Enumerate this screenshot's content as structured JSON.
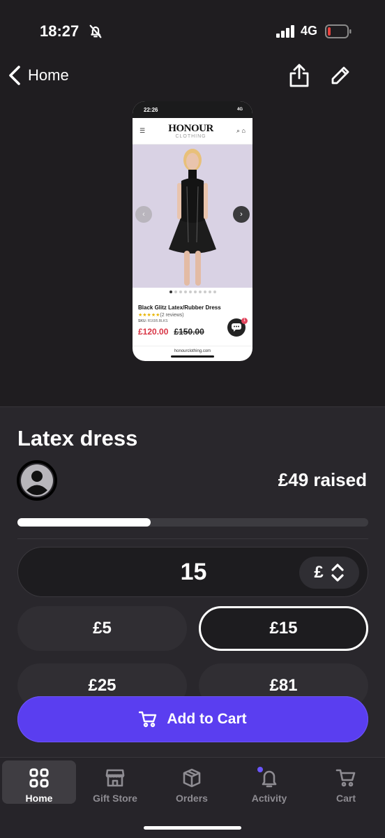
{
  "status_bar": {
    "time": "18:27",
    "network": "4G",
    "icons": [
      "bell-slash-icon",
      "signal-icon",
      "battery-low-icon"
    ]
  },
  "nav": {
    "back_label": "Home",
    "icons": [
      "chevron-left-icon",
      "share-icon",
      "pencil-icon"
    ]
  },
  "preview": {
    "status_time": "22:26",
    "status_network": "4G",
    "brand": "HONOUR",
    "brand_sub": "CLOTHING",
    "product_title": "Black Glitz Latex/Rubber Dress",
    "rating_stars": "★★★★★",
    "reviews": "(2 reviews)",
    "sku_label": "SKU:",
    "sku": "R1695.BLKS",
    "price_now": "£120.00",
    "price_was": "£150.00",
    "chat_badge": "1",
    "url": "honourclothing.com"
  },
  "item": {
    "title": "Latex dress",
    "raised": "£49 raised",
    "progress_fraction": 0.38
  },
  "amount": {
    "value": "15",
    "currency": "£"
  },
  "presets": [
    {
      "label": "£5",
      "selected": false
    },
    {
      "label": "£15",
      "selected": true
    },
    {
      "label": "£25",
      "selected": false
    },
    {
      "label": "£81",
      "selected": false
    }
  ],
  "cta": {
    "add_to_cart": "Add to Cart"
  },
  "tabs": [
    {
      "label": "Home",
      "icon": "grid-icon",
      "active": true
    },
    {
      "label": "Gift Store",
      "icon": "store-icon",
      "active": false
    },
    {
      "label": "Orders",
      "icon": "box-icon",
      "active": false
    },
    {
      "label": "Activity",
      "icon": "bell-icon",
      "active": false
    },
    {
      "label": "Cart",
      "icon": "cart-icon",
      "active": false
    }
  ],
  "colors": {
    "background": "#1f1d20",
    "panel": "#29272c",
    "accent": "#5a3ef0",
    "sale_price": "#d83444"
  }
}
